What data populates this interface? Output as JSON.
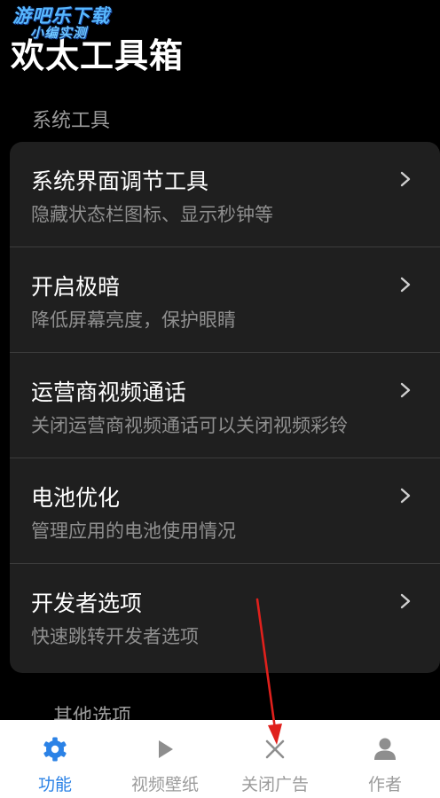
{
  "watermark": {
    "line1": "游吧乐下载",
    "line2": "小编实测"
  },
  "header": {
    "title": "欢太工具箱"
  },
  "section_system": {
    "label": "系统工具",
    "items": [
      {
        "title": "系统界面调节工具",
        "subtitle": "隐藏状态栏图标、显示秒钟等"
      },
      {
        "title": "开启极暗",
        "subtitle": "降低屏幕亮度，保护眼睛"
      },
      {
        "title": "运营商视频通话",
        "subtitle": "关闭运营商视频通话可以关闭视频彩铃"
      },
      {
        "title": "电池优化",
        "subtitle": "管理应用的电池使用情况"
      },
      {
        "title": "开发者选项",
        "subtitle": "快速跳转开发者选项"
      }
    ]
  },
  "section_other": {
    "label": "其他选项"
  },
  "bottom_nav": {
    "items": [
      {
        "label": "功能",
        "icon": "gear-icon",
        "active": true
      },
      {
        "label": "视频壁纸",
        "icon": "play-icon",
        "active": false
      },
      {
        "label": "关闭广告",
        "icon": "close-icon",
        "active": false
      },
      {
        "label": "作者",
        "icon": "person-icon",
        "active": false
      }
    ]
  },
  "colors": {
    "background": "#000000",
    "card": "#1f1f1f",
    "accent": "#2b82e6",
    "annotation_arrow": "#e0201c"
  }
}
